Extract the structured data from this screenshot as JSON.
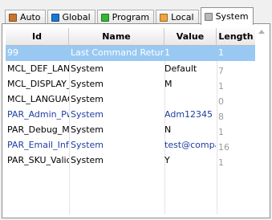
{
  "tabs": [
    {
      "label": "Auto",
      "icon": "puzzle-icon",
      "color": "#c8762e",
      "active": false
    },
    {
      "label": "Global",
      "icon": "blue-square-icon",
      "color": "#1b78d0",
      "active": false
    },
    {
      "label": "Program",
      "icon": "green-square-icon",
      "color": "#35b635",
      "active": false
    },
    {
      "label": "Local",
      "icon": "orange-square-icon",
      "color": "#f0a43a",
      "active": false
    },
    {
      "label": "System",
      "icon": "gray-square-icon",
      "color": "#b8b8b8",
      "active": true
    }
  ],
  "grid": {
    "columns": [
      "Id",
      "Name",
      "Value",
      "Length"
    ],
    "rows": [
      {
        "id": "99",
        "name": "Last Command Return",
        "value": "1",
        "length": "1",
        "selected": true,
        "blue": false
      },
      {
        "id": "MCL_DEF_LANG",
        "name": "System",
        "value": "Default",
        "length": "7",
        "selected": false,
        "blue": false
      },
      {
        "id": "MCL_DISPLAY_M",
        "name": "System",
        "value": "M",
        "length": "1",
        "selected": false,
        "blue": false
      },
      {
        "id": "MCL_LANGUAGE",
        "name": "System",
        "value": "",
        "length": "0",
        "selected": false,
        "blue": false
      },
      {
        "id": "PAR_Admin_Pwd",
        "name": "System",
        "value": "Adm12345",
        "length": "8",
        "selected": false,
        "blue": true
      },
      {
        "id": "PAR_Debug_Mode",
        "name": "System",
        "value": "N",
        "length": "1",
        "selected": false,
        "blue": false
      },
      {
        "id": "PAR_Email_Info",
        "name": "System",
        "value": "test@company",
        "length": "16",
        "selected": false,
        "blue": true
      },
      {
        "id": "PAR_SKU_Valid",
        "name": "System",
        "value": "Y",
        "length": "1",
        "selected": false,
        "blue": false
      }
    ]
  }
}
